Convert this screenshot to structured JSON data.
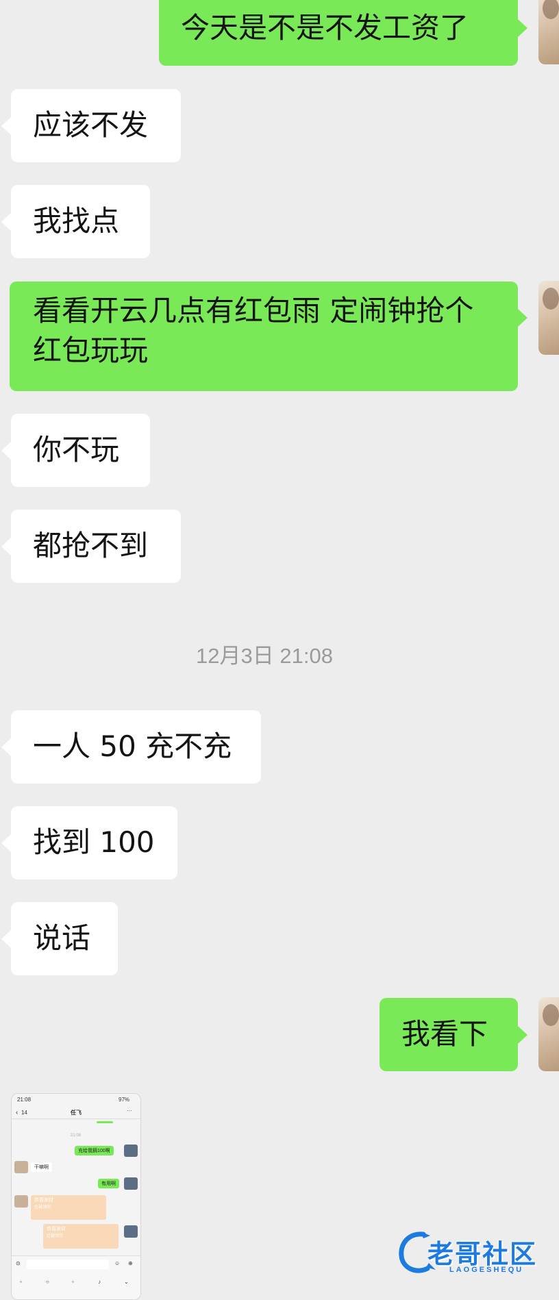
{
  "messages": [
    {
      "side": "out",
      "text": "今天是不是不发工资了"
    },
    {
      "side": "in",
      "text": "应该不发"
    },
    {
      "side": "in",
      "text": "我找点"
    },
    {
      "side": "out",
      "text": "看看开云几点有红包雨 定闹钟抢个红包玩玩"
    },
    {
      "side": "in",
      "text": "你不玩"
    },
    {
      "side": "in",
      "text": "都抢不到"
    },
    {
      "side": "in",
      "text": "一人 50 充不充"
    },
    {
      "side": "in",
      "text": "找到 100"
    },
    {
      "side": "in",
      "text": "说话"
    },
    {
      "side": "out",
      "text": "我看下"
    }
  ],
  "timestamp": "12月3日 21:08",
  "thumbnail": {
    "time": "21:08",
    "battery": "97%",
    "back_count": "14",
    "contact_name": "任飞",
    "inner_time": "21:08",
    "msg_out_1": "充给我摘100啊",
    "msg_in_1": "干嘛啊",
    "msg_out_2": "有用啊",
    "red_packet_label": "恭喜发财",
    "red_packet_sub": "已被领完"
  },
  "watermark": {
    "text": "老哥社区",
    "sub": "LAOGESHEQU"
  },
  "colors": {
    "background": "#ededed",
    "outgoing_bubble": "#7ae957",
    "incoming_bubble": "#ffffff",
    "watermark": "#1d7be0"
  }
}
